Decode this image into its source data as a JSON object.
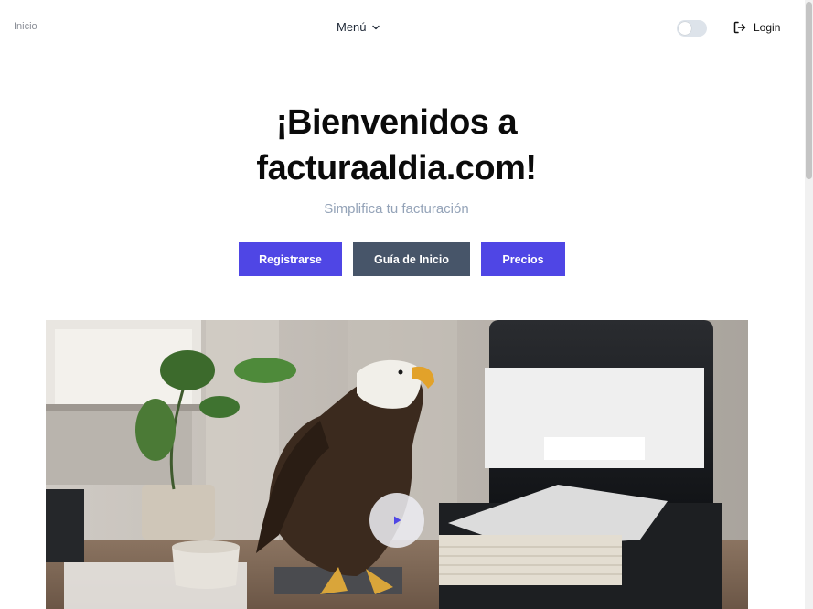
{
  "nav": {
    "home_label": "Inicio",
    "menu_label": "Menú",
    "menu_icon": "chevron-down-icon",
    "login_label": "Login",
    "login_icon": "login-icon",
    "theme_toggle": "off"
  },
  "hero": {
    "title_line1": "¡Bienvenidos a",
    "title_line2": "facturaaldia.com!",
    "subtitle": "Simplifica tu facturación",
    "buttons": {
      "register": "Registrarse",
      "guide": "Guía de Inicio",
      "pricing": "Precios"
    },
    "media": {
      "play_icon": "play-icon"
    }
  },
  "colors": {
    "primary": "#4f46e5",
    "secondary": "#475569",
    "subtitle": "#94a3b8",
    "toggle_track": "#dde3ea"
  }
}
